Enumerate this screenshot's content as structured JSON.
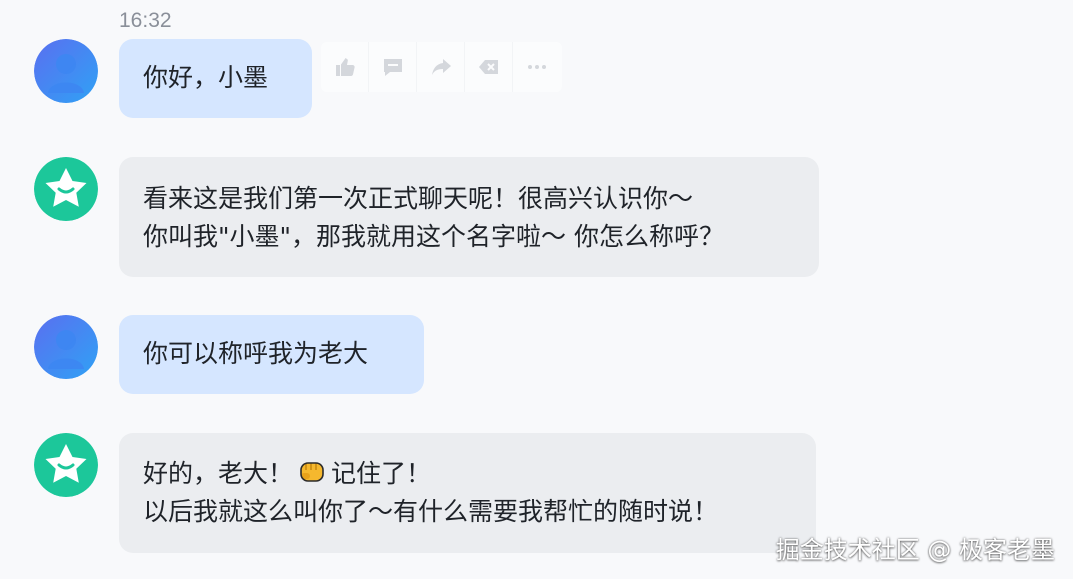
{
  "chat": {
    "timestamp": "16:32",
    "messages": [
      {
        "role": "user",
        "lines": [
          "你好，小墨"
        ]
      },
      {
        "role": "assistant",
        "lines": [
          "看来这是我们第一次正式聊天呢！很高兴认识你～",
          "你叫我\"小墨\"，那我就用这个名字啦～ 你怎么称呼？"
        ]
      },
      {
        "role": "user",
        "lines": [
          "你可以称呼我为老大"
        ]
      },
      {
        "role": "assistant",
        "line1_before_emoji": "好的，老大！",
        "emoji": "fist-emoji",
        "line1_after_emoji": "记住了！",
        "line2": "以后我就这么叫你了～有什么需要我帮忙的随时说！"
      }
    ]
  },
  "message_actions": {
    "icons": [
      "thumbs-up-icon",
      "comment-icon",
      "share-icon",
      "clear-icon",
      "more-icon"
    ]
  },
  "watermark": {
    "text": "掘金技术社区 @ 极客老墨"
  },
  "colors": {
    "page_background": "#f8f9fb",
    "user_bubble": "#d5e6ff",
    "assistant_bubble": "#ebedf0",
    "user_avatar": "#4a7ff0",
    "assistant_avatar": "#1cc79a"
  }
}
